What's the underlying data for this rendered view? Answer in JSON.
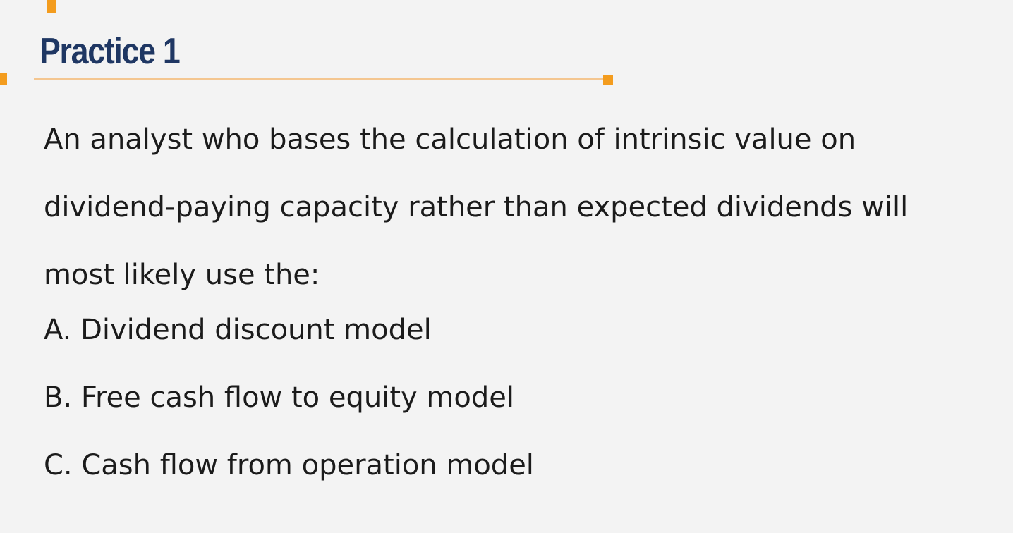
{
  "slide": {
    "title": "Practice 1",
    "question_lines": [
      "An analyst who bases the calculation of intrinsic value on",
      "dividend-paying capacity rather than expected dividends will",
      "most likely use the:"
    ],
    "options": [
      "A. Dividend discount model",
      "B. Free cash flow to equity model",
      "C. Cash flow from operation model"
    ]
  },
  "colors": {
    "background": "#f3f3f3",
    "title": "#1f3763",
    "accent": "#f39c1e",
    "rule": "#f4c690",
    "text": "#1b1b1b"
  }
}
